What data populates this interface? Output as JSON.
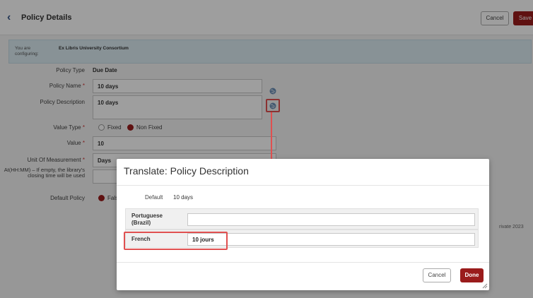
{
  "header": {
    "title": "Policy Details",
    "cancel_label": "Cancel",
    "save_label": "Save"
  },
  "config_bar": {
    "label": "You are configuring:",
    "value": "Ex Libris University Consortium"
  },
  "form": {
    "policy_type": {
      "label": "Policy Type",
      "value": "Due Date"
    },
    "policy_name": {
      "label": "Policy Name",
      "required": "*",
      "value": "10 days"
    },
    "policy_description": {
      "label": "Policy Description",
      "value": "10 days"
    },
    "value_type": {
      "label": "Value Type",
      "required": "*",
      "options": [
        "Fixed",
        "Non Fixed"
      ],
      "selected": "Non Fixed"
    },
    "value": {
      "label": "Value",
      "required": "*",
      "value": "10"
    },
    "unit_of_measurement": {
      "label": "Unit Of Measurement",
      "required": "*",
      "value": "Days"
    },
    "at_time": {
      "label": "At(HH:MM) – If empty, the library's closing time will be used",
      "value": ""
    },
    "default_policy": {
      "label": "Default Policy",
      "selected_partial": "Fals"
    }
  },
  "footer_text": "rivate 2023",
  "dialog": {
    "title": "Translate: Policy Description",
    "default_label": "Default",
    "default_value": "10 days",
    "translations": [
      {
        "language": "Portuguese (Brazil)",
        "value": ""
      },
      {
        "language": "French",
        "value": "10 jours"
      }
    ],
    "cancel_label": "Cancel",
    "done_label": "Done"
  },
  "colors": {
    "accent": "#9a1c1c",
    "annotation": "#e05050",
    "config_bar": "#dcecf3"
  }
}
